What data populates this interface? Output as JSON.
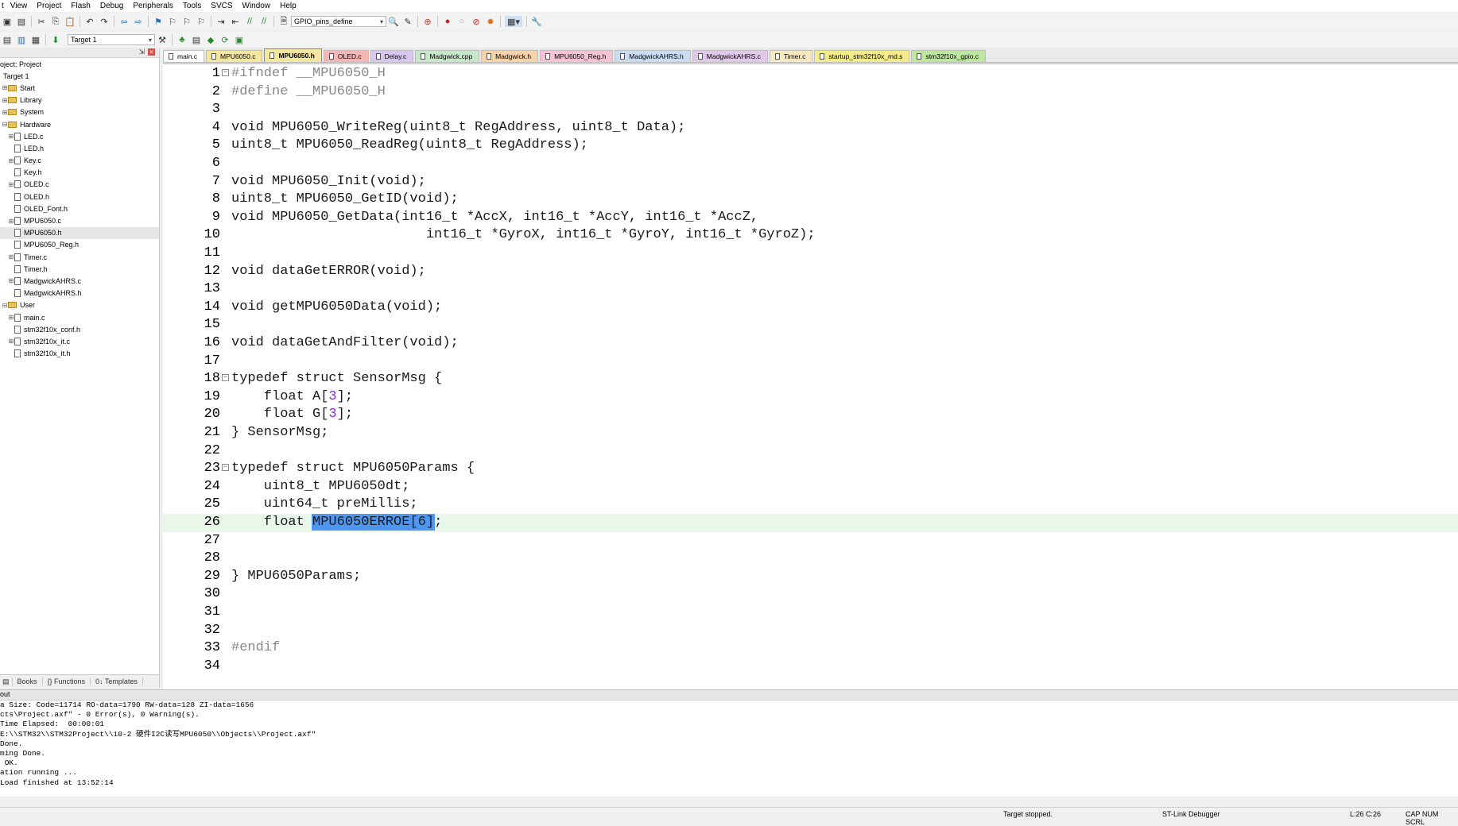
{
  "menu": [
    "View",
    "Project",
    "Flash",
    "Debug",
    "Peripherals",
    "Tools",
    "SVCS",
    "Window",
    "Help"
  ],
  "toolbar": {
    "define_combo": "GPIO_pins_define",
    "target_combo": "Target 1"
  },
  "project": {
    "title": "oject: Project",
    "items": [
      {
        "label": "Target 1",
        "kind": "root",
        "indent": 0,
        "exp": "−"
      },
      {
        "label": "Start",
        "kind": "folder",
        "indent": 0,
        "exp": "+"
      },
      {
        "label": "Library",
        "kind": "folder",
        "indent": 0,
        "exp": "+"
      },
      {
        "label": "System",
        "kind": "folder",
        "indent": 0,
        "exp": "+"
      },
      {
        "label": "Hardware",
        "kind": "folder",
        "indent": 0,
        "exp": "−"
      },
      {
        "label": "LED.c",
        "kind": "file",
        "indent": 1,
        "exp": "+"
      },
      {
        "label": "LED.h",
        "kind": "file",
        "indent": 1,
        "exp": ""
      },
      {
        "label": "Key.c",
        "kind": "file",
        "indent": 1,
        "exp": "+"
      },
      {
        "label": "Key.h",
        "kind": "file",
        "indent": 1,
        "exp": ""
      },
      {
        "label": "OLED.c",
        "kind": "file",
        "indent": 1,
        "exp": "+"
      },
      {
        "label": "OLED.h",
        "kind": "file",
        "indent": 1,
        "exp": ""
      },
      {
        "label": "OLED_Font.h",
        "kind": "file",
        "indent": 1,
        "exp": ""
      },
      {
        "label": "MPU6050.c",
        "kind": "file",
        "indent": 1,
        "exp": "+"
      },
      {
        "label": "MPU6050.h",
        "kind": "file",
        "indent": 1,
        "exp": "",
        "selected": true
      },
      {
        "label": "MPU6050_Reg.h",
        "kind": "file",
        "indent": 1,
        "exp": ""
      },
      {
        "label": "Timer.c",
        "kind": "file",
        "indent": 1,
        "exp": "+"
      },
      {
        "label": "Timer.h",
        "kind": "file",
        "indent": 1,
        "exp": ""
      },
      {
        "label": "MadgwickAHRS.c",
        "kind": "file",
        "indent": 1,
        "exp": "+"
      },
      {
        "label": "MadgwickAHRS.h",
        "kind": "file",
        "indent": 1,
        "exp": ""
      },
      {
        "label": "User",
        "kind": "folder",
        "indent": 0,
        "exp": "−"
      },
      {
        "label": "main.c",
        "kind": "file",
        "indent": 1,
        "exp": "+"
      },
      {
        "label": "stm32f10x_conf.h",
        "kind": "file",
        "indent": 1,
        "exp": ""
      },
      {
        "label": "stm32f10x_it.c",
        "kind": "file",
        "indent": 1,
        "exp": "+"
      },
      {
        "label": "stm32f10x_it.h",
        "kind": "file",
        "indent": 1,
        "exp": ""
      }
    ],
    "bottom_tabs": [
      "Books",
      "{} Functions",
      "0↓ Templates"
    ]
  },
  "tabs": [
    {
      "label": "main.c",
      "color": "#ffffff"
    },
    {
      "label": "MPU6050.c",
      "color": "#f5e6a0"
    },
    {
      "label": "MPU6050.h",
      "color": "#f5e6a0",
      "active": true
    },
    {
      "label": "OLED.c",
      "color": "#f4b6b6"
    },
    {
      "label": "Delay.c",
      "color": "#d8c8f0"
    },
    {
      "label": "Madgwick.cpp",
      "color": "#c8e6c8"
    },
    {
      "label": "Madgwick.h",
      "color": "#f8d2a8"
    },
    {
      "label": "MPU6050_Reg.h",
      "color": "#f6c2d6"
    },
    {
      "label": "MadgwickAHRS.h",
      "color": "#c9dcf2"
    },
    {
      "label": "MadgwickAHRS.c",
      "color": "#e0c8e8"
    },
    {
      "label": "Timer.c",
      "color": "#f8e8c0"
    },
    {
      "label": "startup_stm32f10x_md.s",
      "color": "#f4ec8a"
    },
    {
      "label": "stm32f10x_gpio.c",
      "color": "#bfe6a0"
    }
  ],
  "code": [
    {
      "n": "1",
      "t": "#ifndef __MPU6050_H",
      "pp": true,
      "fold": "−"
    },
    {
      "n": "2",
      "t": "#define __MPU6050_H",
      "pp": true
    },
    {
      "n": "3",
      "t": ""
    },
    {
      "n": "4",
      "t": "void MPU6050_WriteReg(uint8_t RegAddress, uint8_t Data);"
    },
    {
      "n": "5",
      "t": "uint8_t MPU6050_ReadReg(uint8_t RegAddress);"
    },
    {
      "n": "6",
      "t": ""
    },
    {
      "n": "7",
      "t": "void MPU6050_Init(void);"
    },
    {
      "n": "8",
      "t": "uint8_t MPU6050_GetID(void);"
    },
    {
      "n": "9",
      "t": "void MPU6050_GetData(int16_t *AccX, int16_t *AccY, int16_t *AccZ,"
    },
    {
      "n": "10",
      "t": "                        int16_t *GyroX, int16_t *GyroY, int16_t *GyroZ);"
    },
    {
      "n": "11",
      "t": ""
    },
    {
      "n": "12",
      "t": "void dataGetERROR(void);"
    },
    {
      "n": "13",
      "t": ""
    },
    {
      "n": "14",
      "t": "void getMPU6050Data(void);"
    },
    {
      "n": "15",
      "t": ""
    },
    {
      "n": "16",
      "t": "void dataGetAndFilter(void);"
    },
    {
      "n": "17",
      "t": ""
    },
    {
      "n": "18",
      "t": "typedef struct SensorMsg {",
      "fold": "−"
    },
    {
      "n": "19",
      "t": "    float A[3];"
    },
    {
      "n": "20",
      "t": "    float G[3];"
    },
    {
      "n": "21",
      "t": "} SensorMsg;"
    },
    {
      "n": "22",
      "t": ""
    },
    {
      "n": "23",
      "t": "typedef struct MPU6050Params {",
      "fold": "−"
    },
    {
      "n": "24",
      "t": "    uint8_t MPU6050dt;"
    },
    {
      "n": "25",
      "t": "    uint64_t preMillis;"
    },
    {
      "n": "26",
      "t": "    float ",
      "sel": "MPU6050ERROE[6]",
      "after": ";",
      "current": true
    },
    {
      "n": "27",
      "t": ""
    },
    {
      "n": "28",
      "t": ""
    },
    {
      "n": "29",
      "t": "} MPU6050Params;"
    },
    {
      "n": "30",
      "t": ""
    },
    {
      "n": "31",
      "t": ""
    },
    {
      "n": "32",
      "t": ""
    },
    {
      "n": "33",
      "t": "#endif",
      "pp": true
    },
    {
      "n": "34",
      "t": ""
    }
  ],
  "output": {
    "title": "out",
    "lines": [
      "a Size: Code=11714 RO-data=1790 RW-data=128 ZI-data=1656",
      "cts\\Project.axf\" - 0 Error(s), 0 Warning(s).",
      "Time Elapsed:  00:00:01",
      "E:\\\\STM32\\\\STM32Project\\\\10-2 硬件I2C读写MPU6050\\\\Objects\\\\Project.axf\"",
      "Done.",
      "ming Done.",
      " OK.",
      "ation running ...",
      "Load finished at 13:52:14"
    ]
  },
  "status": {
    "target": "Target stopped.",
    "debugger": "ST-Link Debugger",
    "position": "L:26 C:26",
    "keys": "CAP NUM SCRL"
  }
}
